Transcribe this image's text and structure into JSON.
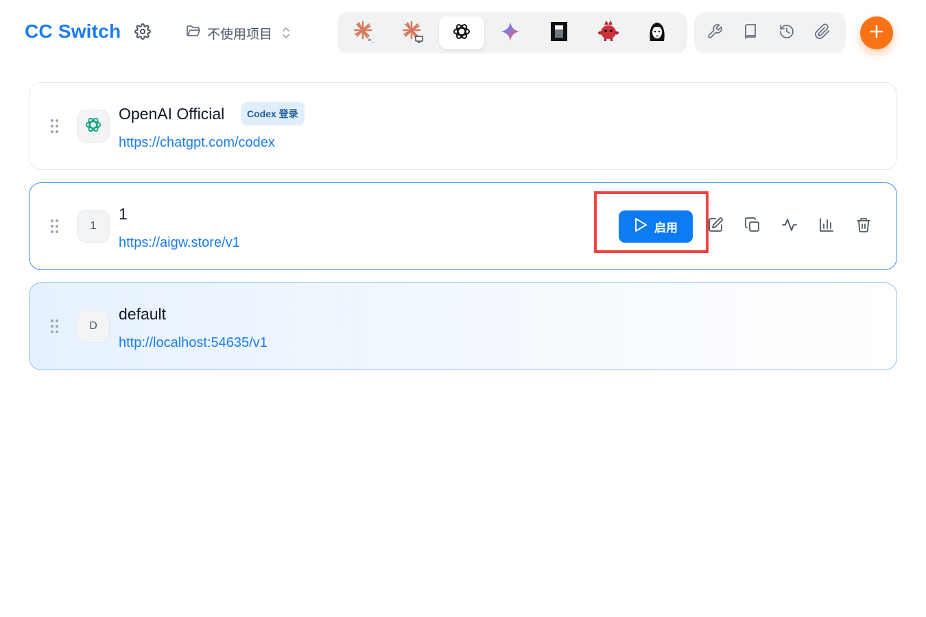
{
  "header": {
    "brand": "CC Switch",
    "project_selector": {
      "label": "不使用项目"
    }
  },
  "app_switcher": {
    "active_index": 2,
    "tabs": [
      {
        "icon": "claude-code-icon"
      },
      {
        "icon": "claude-desktop-icon"
      },
      {
        "icon": "openai-icon"
      },
      {
        "icon": "gemini-icon"
      },
      {
        "icon": "opencode-icon"
      },
      {
        "icon": "red-mascot-icon"
      },
      {
        "icon": "girl-avatar-icon"
      }
    ]
  },
  "toolbar": {
    "tools": [
      "wrench-icon",
      "book-icon",
      "history-icon",
      "paperclip-icon"
    ],
    "add_icon": "plus-icon",
    "accent_color": "#f97316"
  },
  "providers": [
    {
      "name": "OpenAI Official",
      "url": "https://chatgpt.com/codex",
      "badge": "Codex 登录",
      "avatar_icon": "openai-icon"
    },
    {
      "name": "1",
      "url": "https://aigw.store/v1",
      "avatar_letter": "1",
      "enable_label": "启用",
      "actions": [
        "edit-icon",
        "copy-icon",
        "activity-icon",
        "bar-chart-icon",
        "trash-icon"
      ]
    },
    {
      "name": "default",
      "url": "http://localhost:54635/v1",
      "avatar_letter": "D",
      "active": true
    }
  ],
  "colors": {
    "brand": "#1a7cf0",
    "link": "#1a7cf0",
    "primary_button": "#0d7bf2",
    "highlight": "#ef4444"
  }
}
